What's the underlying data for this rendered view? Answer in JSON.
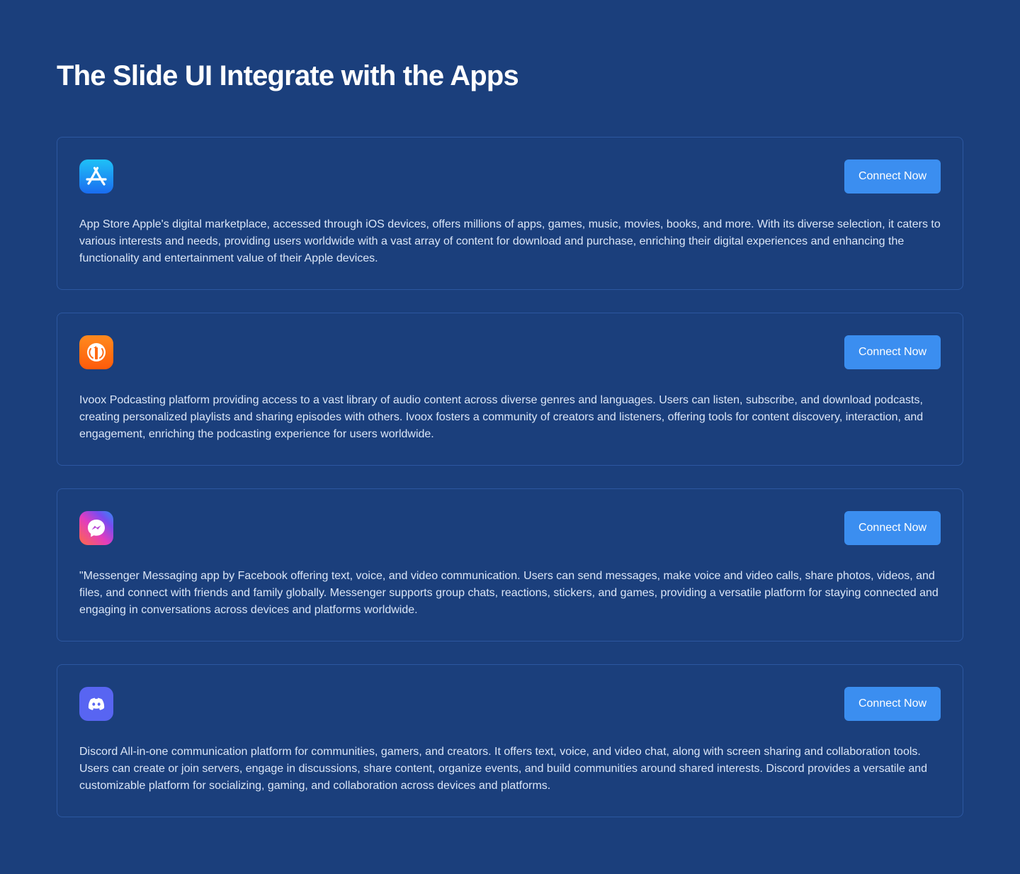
{
  "header": {
    "title": "The Slide UI Integrate with the Apps"
  },
  "apps": [
    {
      "name": "App Store",
      "icon": "app-store-icon",
      "button_label": "Connect Now",
      "description": "App Store Apple's digital marketplace, accessed through iOS devices, offers millions of apps, games, music, movies, books, and more. With its diverse selection, it caters to various interests and needs, providing users worldwide with a vast array of content for download and purchase, enriching their digital experiences and enhancing the functionality and entertainment value of their Apple devices."
    },
    {
      "name": "Ivoox",
      "icon": "ivoox-icon",
      "button_label": "Connect Now",
      "description": "Ivoox Podcasting platform providing access to a vast library of audio content across diverse genres and languages. Users can listen, subscribe, and download podcasts, creating personalized playlists and sharing episodes with others. Ivoox fosters a community of creators and listeners, offering tools for content discovery, interaction, and engagement, enriching the podcasting experience for users worldwide."
    },
    {
      "name": "Messenger",
      "icon": "messenger-icon",
      "button_label": "Connect Now",
      "description": "\"Messenger Messaging app by Facebook offering text, voice, and video communication. Users can send messages, make voice and video calls, share photos, videos, and files, and connect with friends and family globally. Messenger supports group chats, reactions, stickers, and games, providing a versatile platform for staying connected and engaging in conversations across devices and platforms worldwide."
    },
    {
      "name": "Discord",
      "icon": "discord-icon",
      "button_label": "Connect Now",
      "description": "Discord All-in-one communication platform for communities, gamers, and creators. It offers text, voice, and video chat, along with screen sharing and collaboration tools. Users can create or join servers, engage in discussions, share content, organize events, and build communities around shared interests. Discord provides a versatile and customizable platform for socializing, gaming, and collaboration across devices and platforms."
    }
  ],
  "colors": {
    "background": "#1b3f7c",
    "card_border": "#2c57a0",
    "button": "#3b8ef0",
    "text": "#ffffff",
    "description_text": "#dbe6f7"
  }
}
